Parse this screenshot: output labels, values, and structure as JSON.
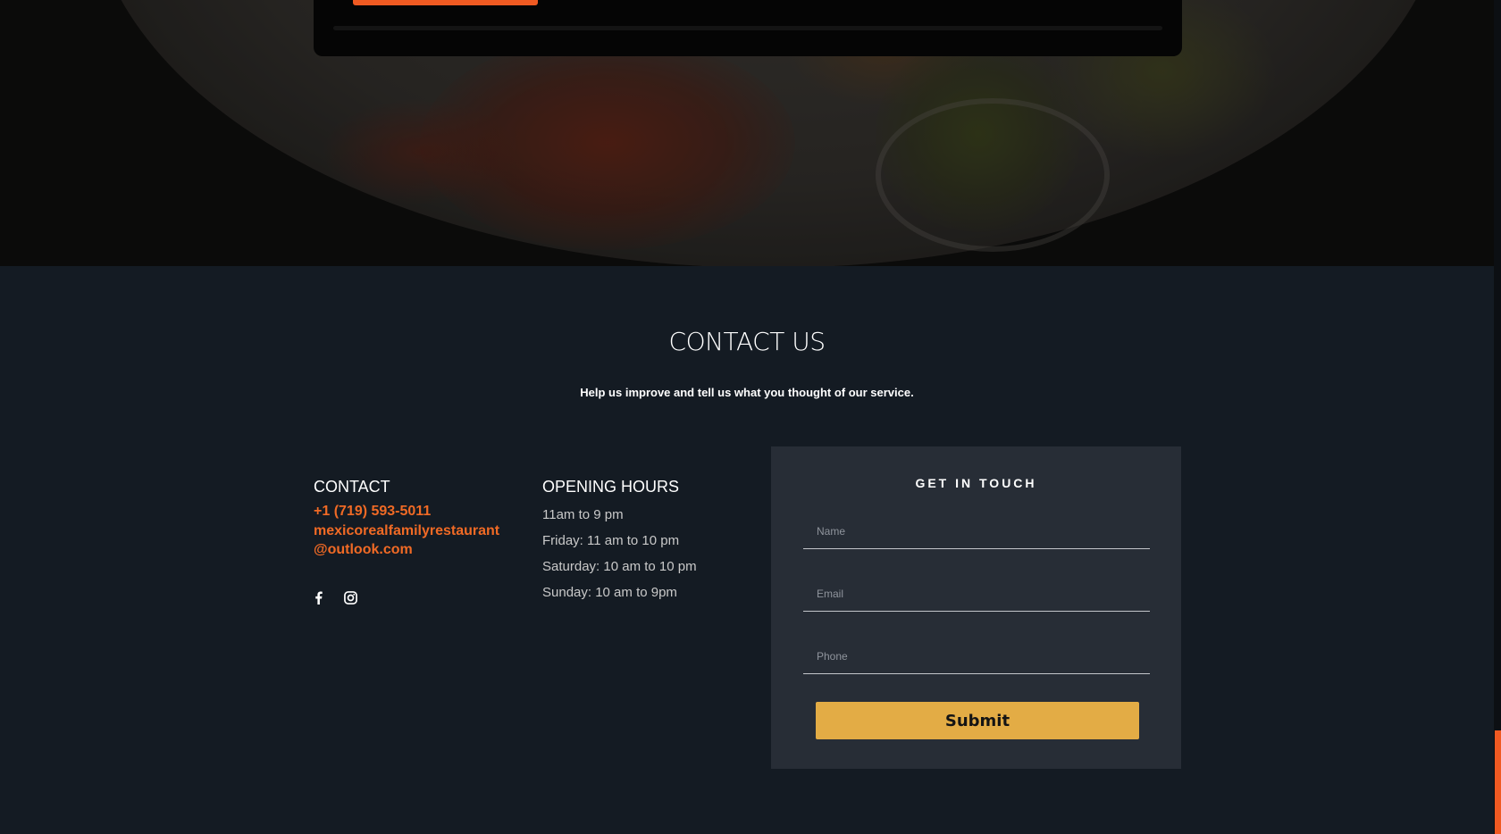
{
  "contact_section": {
    "title": "CONTACT US",
    "subtitle": "Help us improve and tell us what you thought of our service."
  },
  "contact": {
    "heading": "CONTACT",
    "phone": "+1 (719) 593-5011",
    "email": "mexicorealfamilyrestaurant@outlook.com",
    "social": [
      {
        "name": "facebook",
        "icon": "facebook-icon"
      },
      {
        "name": "instagram",
        "icon": "instagram-icon"
      }
    ]
  },
  "hours": {
    "heading": "OPENING HOURS",
    "lines": [
      "11am to 9 pm",
      "Friday: 11 am to 10 pm",
      "Saturday: 10 am to 10 pm",
      "Sunday: 10 am to 9pm"
    ]
  },
  "form": {
    "title": "GET IN TOUCH",
    "name_placeholder": "Name",
    "email_placeholder": "Email",
    "phone_placeholder": "Phone",
    "submit_label": "Submit"
  },
  "colors": {
    "accent_orange": "#f05a22",
    "submit_yellow": "#e3ac45",
    "section_bg": "#141b23",
    "form_bg": "#272d36"
  }
}
